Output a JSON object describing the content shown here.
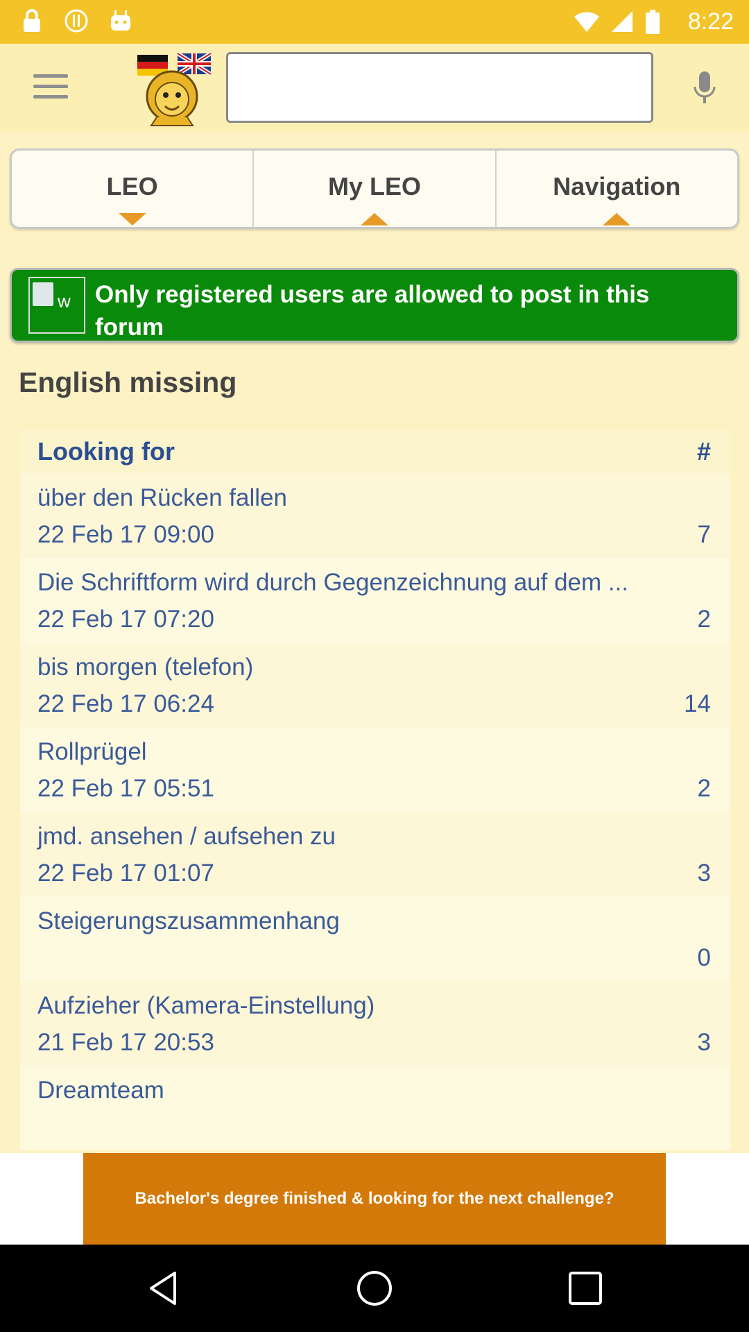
{
  "status_bar": {
    "time": "8:22",
    "icons": [
      "lock-icon",
      "alert-icon",
      "android-icon"
    ],
    "system_icons": [
      "wifi-icon",
      "signal-icon",
      "battery-icon"
    ]
  },
  "appbar": {
    "menu_icon": "menu-icon",
    "logo_icon": "leo-lion-flags-logo",
    "search_value": "",
    "mic_icon": "microphone-icon"
  },
  "tabs": [
    {
      "label": "LEO",
      "indicator": "down"
    },
    {
      "label": "My LEO",
      "indicator": "up"
    },
    {
      "label": "Navigation",
      "indicator": "up"
    }
  ],
  "notice": {
    "image_alt": "w",
    "text": "Only registered users are allowed to post in this forum"
  },
  "section_title": "English missing",
  "list": {
    "header_label": "Looking for",
    "header_count": "#",
    "entries": [
      {
        "title": "über den Rücken fallen",
        "date": "22 Feb 17 09:00",
        "count": "7"
      },
      {
        "title": "Die Schriftform wird durch Gegenzeichnung auf dem ...",
        "date": "22 Feb 17 07:20",
        "count": "2"
      },
      {
        "title": "bis morgen (telefon)",
        "date": "22 Feb 17 06:24",
        "count": "14"
      },
      {
        "title": "Rollprügel",
        "date": "22 Feb 17 05:51",
        "count": "2"
      },
      {
        "title": "jmd. ansehen / aufsehen zu",
        "date": "22 Feb 17 01:07",
        "count": "3"
      },
      {
        "title": "Steigerungszusammenhang",
        "date": "",
        "count": "0"
      },
      {
        "title": "Aufzieher (Kamera-Einstellung)",
        "date": "21 Feb 17 20:53",
        "count": "3"
      },
      {
        "title": "Dreamteam",
        "date": "",
        "count": ""
      }
    ]
  },
  "ad": {
    "text": "Bachelor's degree finished & looking for the next challenge?"
  },
  "colors": {
    "status_bar": "#f4c327",
    "background": "#fdf2c4",
    "notice_green": "#0a8a0a",
    "link_blue": "#3a5a9a",
    "accent_orange": "#e79a26",
    "ad_orange": "#d3790a"
  },
  "navbar": {
    "icons": [
      "back-icon",
      "home-icon",
      "recents-icon"
    ]
  }
}
